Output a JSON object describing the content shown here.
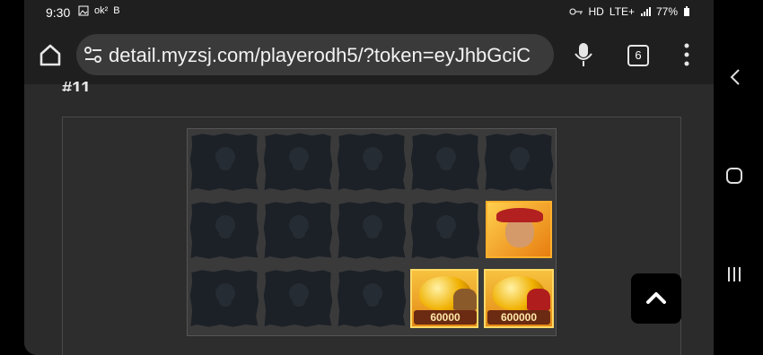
{
  "status": {
    "time": "9:30",
    "left_icons": [
      "image-icon",
      "ok-icon",
      "b-icon"
    ],
    "left_texts": [
      "ok²",
      "B"
    ],
    "right_texts": [
      "HD",
      "LTE+",
      "77%"
    ],
    "right_icons": [
      "key-icon",
      "hd-icon",
      "lte-icon",
      "signal-icon",
      "battery-icon"
    ]
  },
  "browser": {
    "url": "detail.myzsj.com/playerodh5/?token=eyJhbGciC",
    "tab_count": "6"
  },
  "page": {
    "heading": "#11"
  },
  "reel": {
    "tiles": [
      {
        "type": "flag"
      },
      {
        "type": "flag"
      },
      {
        "type": "flag"
      },
      {
        "type": "flag"
      },
      {
        "type": "flag"
      },
      {
        "type": "flag"
      },
      {
        "type": "flag"
      },
      {
        "type": "flag"
      },
      {
        "type": "flag"
      },
      {
        "type": "pirate"
      },
      {
        "type": "flag"
      },
      {
        "type": "flag"
      },
      {
        "type": "flag"
      },
      {
        "type": "gold",
        "amount": "60000"
      },
      {
        "type": "gold",
        "amount": "600000"
      }
    ]
  }
}
